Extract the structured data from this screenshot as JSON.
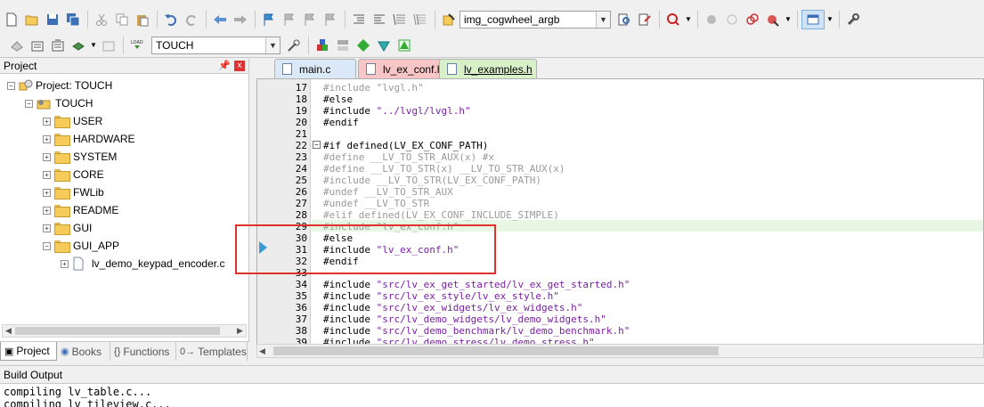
{
  "toolbar1": {
    "target_combo": "img_cogwheel_argb",
    "icons": [
      "new-file-icon",
      "open-folder-icon",
      "save-icon",
      "save-all-icon",
      "cut-icon",
      "copy-icon",
      "paste-icon",
      "undo-icon",
      "redo-icon",
      "nav-back-icon",
      "nav-forward-icon",
      "bookmark-icon",
      "bookmark-prev-icon",
      "bookmark-next-icon",
      "bookmark-clear-icon",
      "indent-icon",
      "unindent-icon",
      "comment-icon",
      "uncomment-icon",
      "find-in-files-icon",
      "find-icon",
      "debug-icon",
      "breakpoint-icon",
      "breakpoint-disable-icon",
      "breakpoint-kill-icon",
      "breakpoint-options-icon",
      "window-layout-icon",
      "configure-icon"
    ]
  },
  "toolbar2": {
    "target_combo": "TOUCH",
    "icons": [
      "translate-icon",
      "build-icon",
      "rebuild-icon",
      "batch-build-icon",
      "stop-build-icon",
      "download-icon",
      "target-options-icon",
      "manage-components-icon",
      "pack-installer-icon",
      "select-packs-icon",
      "rte-icon",
      "pack-manager-icon"
    ],
    "load_label": "LOAD"
  },
  "project_panel": {
    "title": "Project",
    "pin": " ",
    "close": "x",
    "tree": [
      {
        "label": "Project: TOUCH",
        "expander": "−",
        "level": 0
      },
      {
        "label": "TOUCH",
        "expander": "−",
        "level": 1
      },
      {
        "label": "USER",
        "expander": "+",
        "level": 2
      },
      {
        "label": "HARDWARE",
        "expander": "+",
        "level": 2
      },
      {
        "label": "SYSTEM",
        "expander": "+",
        "level": 2
      },
      {
        "label": "CORE",
        "expander": "+",
        "level": 2
      },
      {
        "label": "FWLib",
        "expander": "+",
        "level": 2
      },
      {
        "label": "README",
        "expander": "+",
        "level": 2
      },
      {
        "label": "GUI",
        "expander": "+",
        "level": 2
      },
      {
        "label": "GUI_APP",
        "expander": "−",
        "level": 2
      },
      {
        "label": "lv_demo_keypad_encoder.c",
        "expander": "+",
        "level": 3
      }
    ],
    "tabs": [
      {
        "label": "Project",
        "icon": "project-tab-icon",
        "active": true
      },
      {
        "label": "Books",
        "icon": "books-icon",
        "active": false
      },
      {
        "label": "Functions",
        "icon": "functions-icon",
        "prefix": "{}",
        "active": false
      },
      {
        "label": "Templates",
        "icon": "templates-icon",
        "prefix": "0→",
        "active": false
      }
    ]
  },
  "editor": {
    "tabs": [
      {
        "label": "main.c",
        "active": false,
        "color": "#dbe8f7"
      },
      {
        "label": "lv_ex_conf.h",
        "active": false,
        "color": "#f8c6c6"
      },
      {
        "label": "lv_examples.h",
        "active": true,
        "color": "#d8f0c8"
      }
    ],
    "lines": [
      {
        "num": "17",
        "text": "#include \"lvgl.h\"",
        "dim": true
      },
      {
        "num": "18",
        "text": "#else",
        "dim": false
      },
      {
        "num": "19",
        "text": "#include \"../lvgl/lvgl.h\"",
        "dim": false
      },
      {
        "num": "20",
        "text": "#endif",
        "dim": false
      },
      {
        "num": "21",
        "text": "",
        "dim": false
      },
      {
        "num": "22",
        "text": "#if defined(LV_EX_CONF_PATH)",
        "dim": false,
        "fold": true
      },
      {
        "num": "23",
        "text": "#define __LV_TO_STR_AUX(x) #x",
        "dim": true
      },
      {
        "num": "24",
        "text": "#define __LV_TO_STR(x) __LV_TO_STR_AUX(x)",
        "dim": true
      },
      {
        "num": "25",
        "text": "#include __LV_TO_STR(LV_EX_CONF_PATH)",
        "dim": true
      },
      {
        "num": "26",
        "text": "#undef __LV_TO_STR_AUX",
        "dim": true
      },
      {
        "num": "27",
        "text": "#undef __LV_TO_STR",
        "dim": true
      },
      {
        "num": "28",
        "text": "#elif defined(LV_EX_CONF_INCLUDE_SIMPLE)",
        "dim": true
      },
      {
        "num": "29",
        "text": "#include \"lv_ex_conf.h\"",
        "dim": true,
        "highlight": true
      },
      {
        "num": "30",
        "text": "#else",
        "dim": false
      },
      {
        "num": "31",
        "text": "#include \"lv_ex_conf.h\"",
        "dim": false
      },
      {
        "num": "32",
        "text": "#endif",
        "dim": false
      },
      {
        "num": "33",
        "text": "",
        "dim": false
      },
      {
        "num": "34",
        "text": "#include \"src/lv_ex_get_started/lv_ex_get_started.h\"",
        "dim": false
      },
      {
        "num": "35",
        "text": "#include \"src/lv_ex_style/lv_ex_style.h\"",
        "dim": false
      },
      {
        "num": "36",
        "text": "#include \"src/lv_ex_widgets/lv_ex_widgets.h\"",
        "dim": false
      },
      {
        "num": "37",
        "text": "#include \"src/lv_demo_widgets/lv_demo_widgets.h\"",
        "dim": false
      },
      {
        "num": "38",
        "text": "#include \"src/lv_demo_benchmark/lv_demo_benchmark.h\"",
        "dim": false
      },
      {
        "num": "39",
        "text": "#include \"src/lv_demo_stress/lv_demo_stress.h\"",
        "dim": false
      }
    ]
  },
  "build_output": {
    "title": "Build Output",
    "lines": [
      "compiling lv_table.c...",
      "compiling lv_tileview.c..."
    ]
  },
  "colors": {
    "annotation_box": "#e0322c",
    "string": "#7a1fa2",
    "inactive_code": "#9a9a9a"
  }
}
